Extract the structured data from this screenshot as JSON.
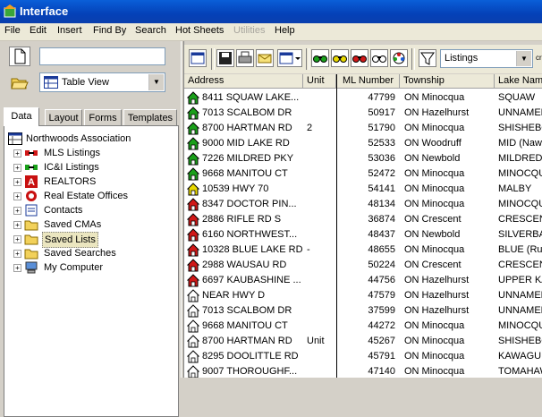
{
  "window": {
    "title": "Interface"
  },
  "menu": [
    "File",
    "Edit",
    "Insert",
    "Find By",
    "Search",
    "Hot Sheets",
    "Utilities",
    "Help"
  ],
  "left": {
    "search_value": "",
    "view_select": "Table View",
    "tabs": [
      "Data",
      "Layout",
      "Forms",
      "Templates"
    ],
    "active_tab": "Data",
    "tree_root": "Northwoods Association",
    "tree_items": [
      "MLS Listings",
      "IC&I Listings",
      "REALTORS",
      "Real Estate Offices",
      "Contacts",
      "Saved CMAs",
      "Saved Lists",
      "Saved Searches",
      "My Computer"
    ],
    "selected_item": "Saved Lists"
  },
  "toolbar": {
    "listing_select": "Listings",
    "cutoff_text": "cr"
  },
  "table": {
    "columns": [
      "Address",
      "Unit",
      "ML Number",
      "Township",
      "Lake Name"
    ],
    "rows": [
      {
        "address": "8411 SQUAW LAKE...",
        "unit": "",
        "ml": "47799",
        "township": "ON Minocqua",
        "lake": "SQUAW",
        "status": "active"
      },
      {
        "address": "7013 SCALBOM DR",
        "unit": "",
        "ml": "50917",
        "township": "ON Hazelhurst",
        "lake": "UNNAMED",
        "status": "active"
      },
      {
        "address": "8700 HARTMAN RD",
        "unit": "2",
        "ml": "51790",
        "township": "ON Minocqua",
        "lake": "SHISHEBO",
        "status": "active"
      },
      {
        "address": "9000 MID LAKE RD",
        "unit": "",
        "ml": "52533",
        "township": "ON Woodruff",
        "lake": "MID  (Naw",
        "status": "active"
      },
      {
        "address": "7226 MILDRED PKY",
        "unit": "",
        "ml": "53036",
        "township": "ON Newbold",
        "lake": "MILDRED",
        "status": "active"
      },
      {
        "address": "9668 MANITOU CT",
        "unit": "",
        "ml": "52472",
        "township": "ON Minocqua",
        "lake": "MINOCQU",
        "status": "active"
      },
      {
        "address": "10539 HWY 70",
        "unit": "",
        "ml": "54141",
        "township": "ON Minocqua",
        "lake": "MALBY",
        "status": "pending"
      },
      {
        "address": "8347 DOCTOR PIN...",
        "unit": "",
        "ml": "48134",
        "township": "ON Minocqua",
        "lake": "MINOCQU",
        "status": "sold"
      },
      {
        "address": "2886 RIFLE RD S",
        "unit": "",
        "ml": "36874",
        "township": "ON Crescent",
        "lake": "CRESCENT",
        "status": "sold"
      },
      {
        "address": "6160 NORTHWEST...",
        "unit": "",
        "ml": "48437",
        "township": "ON Newbold",
        "lake": "SILVERBA",
        "status": "sold"
      },
      {
        "address": "10328 BLUE LAKE RD",
        "unit": "-",
        "ml": "48655",
        "township": "ON Minocqua",
        "lake": "BLUE  (Rus",
        "status": "sold"
      },
      {
        "address": "2988 WAUSAU RD",
        "unit": "",
        "ml": "50224",
        "township": "ON Crescent",
        "lake": "CRESCENT",
        "status": "sold"
      },
      {
        "address": "6697 KAUBASHINE ...",
        "unit": "",
        "ml": "44756",
        "township": "ON Hazelhurst",
        "lake": "UPPER KA",
        "status": "sold"
      },
      {
        "address": "NEAR HWY D",
        "unit": "",
        "ml": "47579",
        "township": "ON Hazelhurst",
        "lake": "UNNAMED",
        "status": "expired"
      },
      {
        "address": "7013 SCALBOM DR",
        "unit": "",
        "ml": "37599",
        "township": "ON Hazelhurst",
        "lake": "UNNAMED",
        "status": "expired"
      },
      {
        "address": "9668 MANITOU CT",
        "unit": "",
        "ml": "44272",
        "township": "ON Minocqua",
        "lake": "MINOCQU",
        "status": "expired"
      },
      {
        "address": "8700 HARTMAN RD",
        "unit": "Unit",
        "ml": "45267",
        "township": "ON Minocqua",
        "lake": "SHISHEBO",
        "status": "expired"
      },
      {
        "address": "8295 DOOLITTLE RD",
        "unit": "",
        "ml": "45791",
        "township": "ON Minocqua",
        "lake": "KAWAGUE",
        "status": "expired"
      },
      {
        "address": "9007 THOROUGHF...",
        "unit": "",
        "ml": "47140",
        "township": "ON Minocqua",
        "lake": "TOMAHAW",
        "status": "expired"
      }
    ]
  },
  "colors": {
    "active": "#1aa01a",
    "pending": "#e8d800",
    "sold": "#d01818",
    "expired": "#ffffff"
  }
}
